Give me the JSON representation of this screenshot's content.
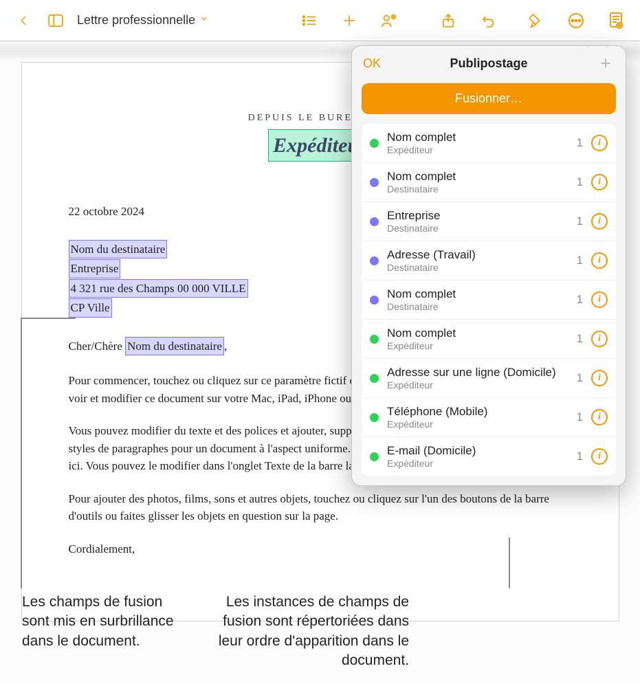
{
  "toolbar": {
    "doc_title": "Lettre professionnelle"
  },
  "page": {
    "heading_small": "DEPUIS LE BUREAU DE",
    "heading_main": "Expéditeur",
    "date": "22 octobre 2024",
    "field_recipient_name": "Nom du destinataire",
    "field_company": "Entreprise",
    "field_address": "4 321 rue des Champs 00 000 VILLE",
    "field_city": "CP Ville",
    "greeting_prefix": "Cher/Chère ",
    "field_recipient_name2": "Nom du destinataire",
    "para1": "Pour commencer, touchez ou cliquez sur ce paramètre fictif et commencez à saisir du texte. Vous pouvez voir et modifier ce document sur votre Mac, iPad, iPhone ou dans un navigateur.",
    "para2": "Vous pouvez modifier du texte et des polices et ajouter, supprimer ou réarranger les sections. Utilisez des styles de paragraphes pour un document à l'aspect uniforme. Par exemple, le style Sous-section est utilisé ici. Vous pouvez le modifier dans l'onglet Texte de la barre latérale Format.",
    "para3": "Pour ajouter des photos, films, sons et autres objets, touchez ou cliquez sur l'un des boutons de la barre d'outils ou faites glisser les objets en question sur la page.",
    "closing": "Cordialement,"
  },
  "popover": {
    "ok": "OK",
    "title": "Publipostage",
    "fuse": "Fusionner…",
    "fields": [
      {
        "dot": "g",
        "name": "Nom complet",
        "sub": "Expéditeur",
        "count": "1"
      },
      {
        "dot": "p",
        "name": "Nom complet",
        "sub": "Destinataire",
        "count": "1"
      },
      {
        "dot": "p",
        "name": "Entreprise",
        "sub": "Destinataire",
        "count": "1"
      },
      {
        "dot": "p",
        "name": "Adresse (Travail)",
        "sub": "Destinataire",
        "count": "1"
      },
      {
        "dot": "p",
        "name": "Nom complet",
        "sub": "Destinataire",
        "count": "1"
      },
      {
        "dot": "g",
        "name": "Nom complet",
        "sub": "Expéditeur",
        "count": "1"
      },
      {
        "dot": "g",
        "name": "Adresse sur une ligne (Domicile)",
        "sub": "Expéditeur",
        "count": "1"
      },
      {
        "dot": "g",
        "name": "Téléphone (Mobile)",
        "sub": "Expéditeur",
        "count": "1"
      },
      {
        "dot": "g",
        "name": "E-mail (Domicile)",
        "sub": "Expéditeur",
        "count": "1"
      }
    ]
  },
  "callouts": {
    "left": "Les champs de fusion sont mis en surbrillance dans le document.",
    "right": "Les instances de champs de fusion sont répertoriées dans leur ordre d'apparition dans le document."
  }
}
